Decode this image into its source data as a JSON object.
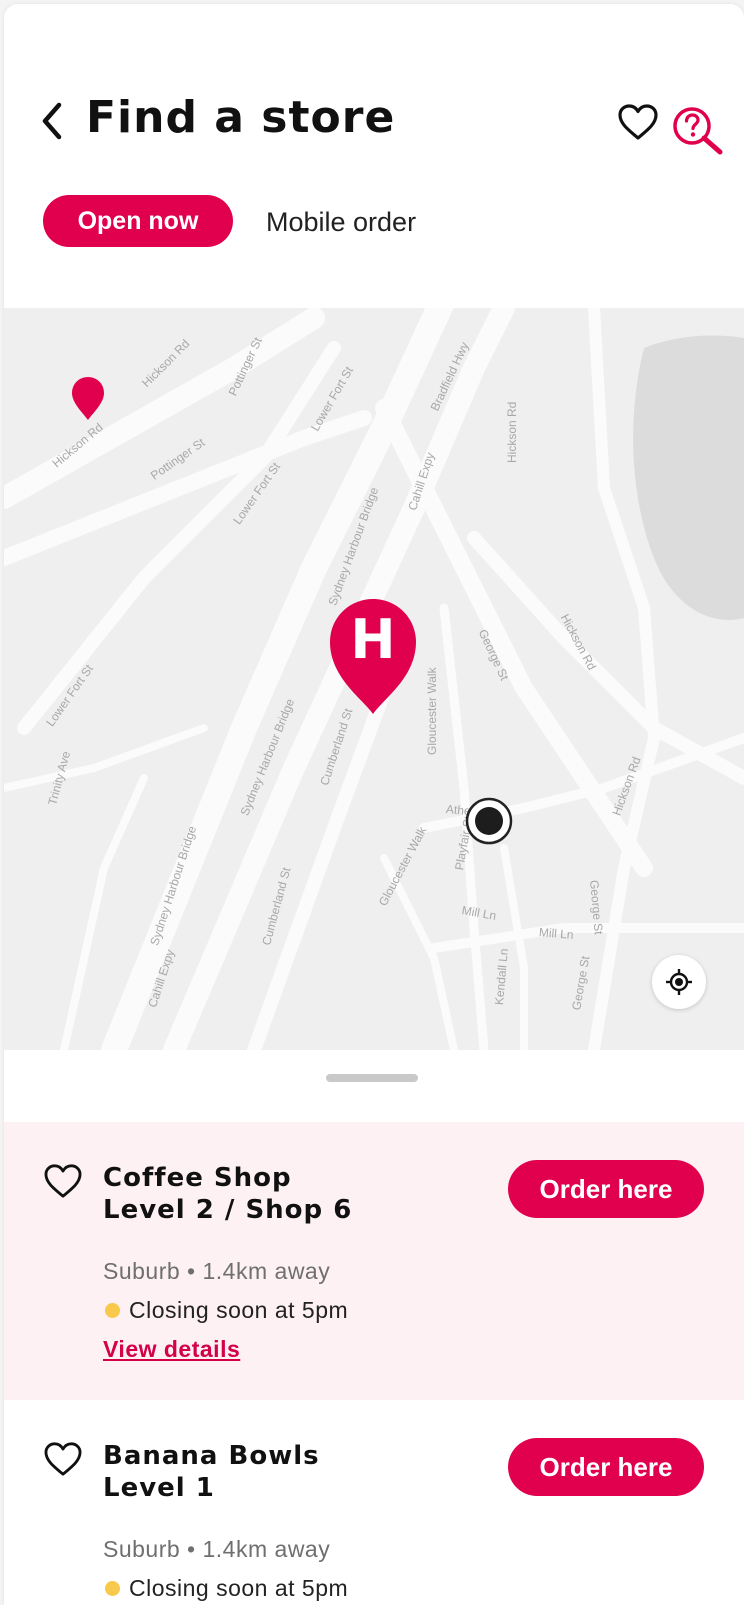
{
  "header": {
    "title": "Find a store",
    "back_icon": "chevron-left-icon",
    "favourite_icon": "heart-outline-icon",
    "help_icon": "help-search-icon"
  },
  "filters": {
    "active": "Open now",
    "secondary": "Mobile order"
  },
  "map": {
    "street_labels": [
      "Hickson Rd",
      "Hickson Rd",
      "Pottinger St",
      "Pottinger St",
      "Lower Fort St",
      "Lower Fort St",
      "Lower Fort St",
      "Bradfield Hwy",
      "Sydney Harbour Bridge",
      "Cahill Expy",
      "Hickson Rd",
      "Sydney Harbour Bridge",
      "Sydney Harbour Bridge",
      "Cumberland St",
      "Cumberland St",
      "Gloucester Walk",
      "Gloucester Walk",
      "George St",
      "Hickson Rd",
      "George St",
      "George St",
      "Trinity Ave",
      "Cahill Expy",
      "Mill Ln",
      "Mill Ln",
      "Kendall Ln",
      "Hickson Rd",
      "Atherden St",
      "Playfair St"
    ],
    "store_pin_letter": "H",
    "brand_color": "#e0004d",
    "locate_icon": "crosshair-icon"
  },
  "stores": [
    {
      "name_line1": "Coffee Shop",
      "name_line2": "Level 2 / Shop 6",
      "order_label": "Order here",
      "distance": "Suburb • 1.4km away",
      "status": "Closing soon at 5pm",
      "status_color": "#f8c94a",
      "details_link": "View details"
    },
    {
      "name_line1": "Banana Bowls",
      "name_line2": "Level 1",
      "order_label": "Order here",
      "distance": "Suburb • 1.4km away",
      "status": "Closing soon at 5pm",
      "status_color": "#f8c94a"
    }
  ]
}
